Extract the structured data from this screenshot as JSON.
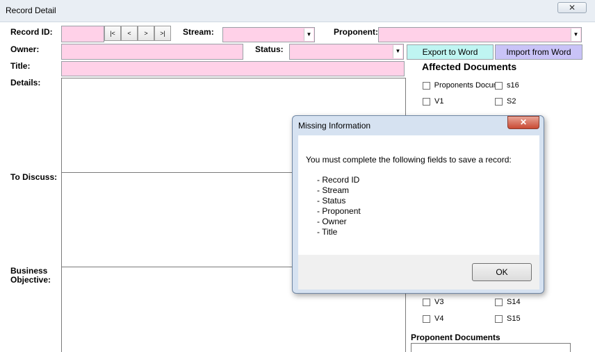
{
  "window": {
    "title": "Record Detail",
    "close_glyph": "✕"
  },
  "form": {
    "record_id_label": "Record ID:",
    "stream_label": "Stream:",
    "proponent_label": "Proponent:",
    "owner_label": "Owner:",
    "status_label": "Status:",
    "title_label": "Title:",
    "details_label": "Details:",
    "to_discuss_label": "To Discuss:",
    "business_objective_label_line1": "Business",
    "business_objective_label_line2": "Objective:",
    "record_id_value": "",
    "stream_value": "",
    "proponent_value": "",
    "owner_value": "",
    "status_value": "",
    "title_value": "",
    "nav": {
      "first": "|<",
      "prev": "<",
      "next": ">",
      "last": ">|"
    },
    "combo_arrow": "▼"
  },
  "buttons": {
    "export_label": "Export to Word",
    "import_label": "Import from Word"
  },
  "affected_documents": {
    "title": "Affected Documents",
    "items_top": [
      {
        "label": "Proponents Docun",
        "checked": false
      },
      {
        "label": "s16",
        "checked": false
      },
      {
        "label": "V1",
        "checked": false
      },
      {
        "label": "S2",
        "checked": false
      }
    ],
    "items_bottom": [
      {
        "label": "V3",
        "checked": false
      },
      {
        "label": "S14",
        "checked": false
      },
      {
        "label": "V4",
        "checked": false
      },
      {
        "label": "S15",
        "checked": false
      }
    ]
  },
  "proponent_documents": {
    "title": "Proponent Documents"
  },
  "dialog": {
    "title": "Missing Information",
    "close_glyph": "✕",
    "message": "You must complete the following fields to save a record:",
    "fields": [
      "- Record ID",
      "- Stream",
      "- Status",
      "- Proponent",
      "- Owner",
      "- Title"
    ],
    "ok_label": "OK"
  },
  "colors": {
    "required_field": "#ffd1e8",
    "export_button": "#bff5f2",
    "import_button": "#c9c3f7",
    "dialog_frame": "#d6e2f1"
  }
}
